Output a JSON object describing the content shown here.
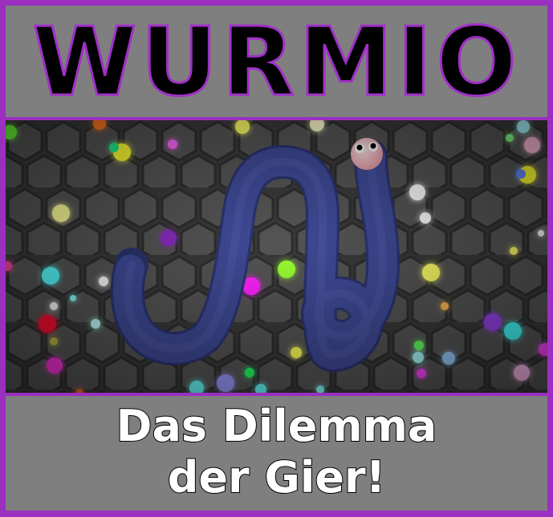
{
  "title": "WURMIO",
  "subtitle": {
    "line1": "Das Dilemma",
    "line2": "der Gier!"
  },
  "colors": {
    "frame": "#9a2fc0",
    "panel": "#7f7f7f",
    "title_text": "#000000",
    "title_outline": "#a02fc8",
    "subtitle_text": "#ffffff",
    "worm_body": "#3d4890",
    "worm_head": "#f2b8bf",
    "hex_floor": "#4a4a4a"
  },
  "game": {
    "player_worm": {
      "name": "",
      "head": "pink-head-icon",
      "eyes": 2
    },
    "food_orbs": [
      "green",
      "magenta",
      "yellow",
      "white",
      "cyan",
      "red",
      "purple",
      "pink",
      "orange",
      "blue"
    ]
  }
}
